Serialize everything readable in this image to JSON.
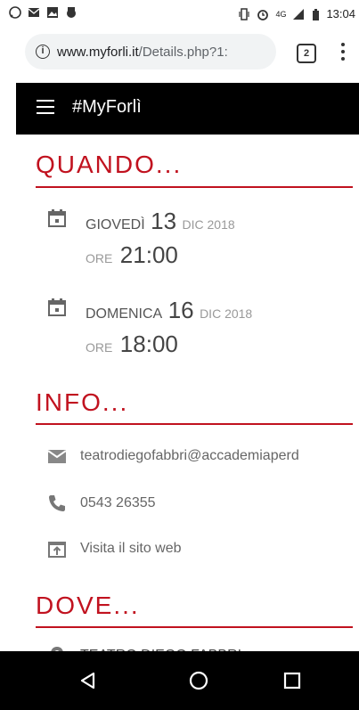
{
  "status_bar": {
    "time": "13:04",
    "network": "4G"
  },
  "browser": {
    "url_domain": "www.myforli.it",
    "url_path": "/Details.php?1:",
    "tab_count": "2"
  },
  "app": {
    "title": "#MyForlì"
  },
  "sections": {
    "quando": "QUANDO...",
    "info": "INFO...",
    "dove": "DOVE..."
  },
  "events": [
    {
      "day_name": "GIOVEDÌ",
      "day_num": "13",
      "month_year": "DIC 2018",
      "ore_label": "ORE",
      "time": "21:00"
    },
    {
      "day_name": "DOMENICA",
      "day_num": "16",
      "month_year": "DIC 2018",
      "ore_label": "ORE",
      "time": "18:00"
    }
  ],
  "info": {
    "email": "teatrodiegofabbri@accademiaperd",
    "phone": "0543 26355",
    "website": "Visita il sito web"
  },
  "location": {
    "name": "TEATRO DIEGO FABBRI"
  },
  "icons": [
    "whatsapp-icon",
    "gmail-icon",
    "image-icon",
    "bug-icon",
    "vibrate-icon",
    "alarm-icon",
    "signal-icon",
    "battery-icon",
    "info-icon",
    "calendar-icon",
    "mail-icon",
    "phone-icon",
    "open-in-new-icon",
    "location-pin-icon",
    "back-icon",
    "home-icon",
    "recents-icon"
  ],
  "colors": {
    "accent": "#c1121f",
    "appbar": "#000000"
  }
}
